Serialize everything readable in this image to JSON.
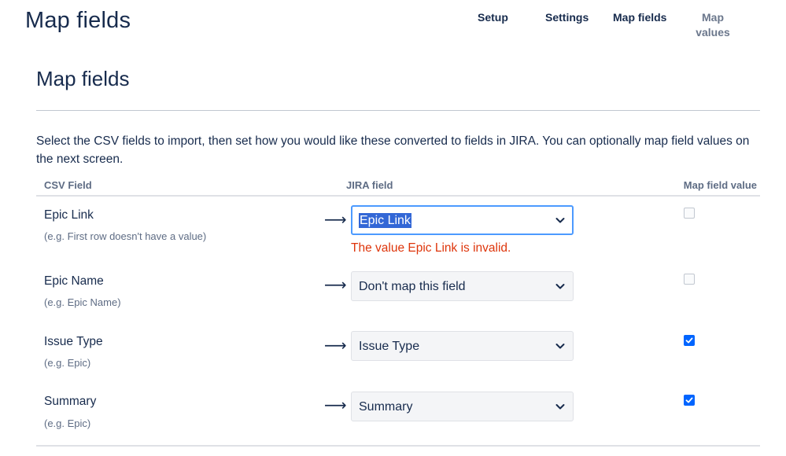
{
  "header": {
    "title": "Map fields",
    "steps": [
      "Setup",
      "Settings",
      "Map fields",
      "Map values"
    ],
    "current_step": "Map fields"
  },
  "main": {
    "heading": "Map fields",
    "description": "Select the CSV fields to import, then set how you would like these converted to fields in JIRA. You can optionally map field values on the next screen.",
    "columns": {
      "csv": "CSV Field",
      "jira": "JIRA field",
      "map": "Map field value"
    },
    "rows": [
      {
        "csv_field": "Epic Link",
        "example": "(e.g. First row doesn't have a value)",
        "arrow": "⟶",
        "jira_field": "Epic Link",
        "error": "The value Epic Link is invalid.",
        "map_value": false,
        "focused": true
      },
      {
        "csv_field": "Epic Name",
        "example": "(e.g. Epic Name)",
        "arrow": "⟶",
        "jira_field": "Don't map this field",
        "map_value": false
      },
      {
        "csv_field": "Issue Type",
        "example": "(e.g. Epic)",
        "arrow": "⟶",
        "jira_field": "Issue Type",
        "map_value": true
      },
      {
        "csv_field": "Summary",
        "example": "(e.g. Epic)",
        "arrow": "⟶",
        "jira_field": "Summary",
        "map_value": true
      }
    ]
  },
  "colors": {
    "text": "#172b4d",
    "muted": "#5e6c84",
    "error": "#de350b",
    "focus": "#4c9aff",
    "checkbox_checked": "#0065ff",
    "selection": "#3367d6"
  },
  "icons": {
    "dropdown": "chevron-down-icon",
    "checked": "checkmark-icon"
  }
}
